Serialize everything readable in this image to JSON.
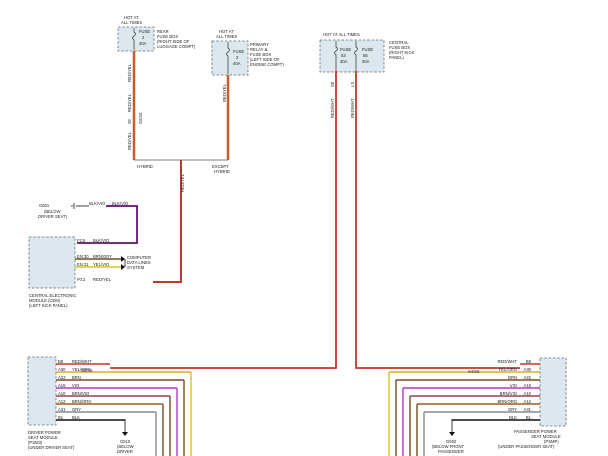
{
  "fuse_rear": {
    "hot": [
      "HOT AT",
      "ALL TIMES"
    ],
    "fuse": [
      "FUSE",
      "2",
      "40A"
    ],
    "location": [
      "REAR",
      "FUSE BOX",
      "(RIGHT SIDE OF",
      "LUGGAGE COMPT)"
    ]
  },
  "fuse_primary": {
    "hot": [
      "HOT AT",
      "ALL TIMES"
    ],
    "fuse": [
      "FUSE",
      "3",
      "40A"
    ],
    "location": [
      "PRIMARY",
      "RELAY &",
      "FUSE BOX",
      "(LEFT SIDE OF",
      "ENGINE COMPT)"
    ]
  },
  "fuse_central": {
    "hot": "HOT AT ALL TIMES",
    "fuse_a": [
      "FUSE",
      "53",
      "30A"
    ],
    "fuse_b": [
      "FUSE",
      "55",
      "30A"
    ],
    "location": [
      "CENTRAL",
      "FUSE BOX",
      "(RIGHT KICK",
      "PANEL)"
    ]
  },
  "wires": {
    "red_yel": "RED/YEL",
    "red_wht": "RED/WHT",
    "blk_vio": "BLK/VIO",
    "code_28": "28",
    "code_s8": "S8",
    "code_ls": "LS",
    "splice_label": "S4/S5",
    "hybrid": "HYBRID",
    "except_hybrid": [
      "EXCEPT",
      "HYBRID"
    ]
  },
  "ground_left": {
    "id": "G601",
    "wire": "BLK/VIO",
    "location": [
      "(BELOW",
      "DRIVER SEAT)"
    ]
  },
  "cem": {
    "pins": [
      {
        "pin": "F2:6",
        "wire": "BLK/VIO"
      },
      {
        "pin": "EN:30",
        "wire": "BRN/GRY"
      },
      {
        "pin": "EN:31",
        "wire": "YEL/VIO"
      },
      {
        "pin": "F0:2",
        "wire": "RED/YEL"
      }
    ],
    "network": [
      "COMPUTER",
      "DATA LINES",
      "SYSTEM"
    ],
    "name": [
      "CENTRAL ELECTRONIC",
      "MODULE (CEM)",
      "(LEFT KICK PANEL)"
    ]
  },
  "driver_module": {
    "pins": [
      {
        "pin": "B8",
        "wire": "RED/WHT"
      },
      {
        "pin": "A30",
        "wire": "YEL/ORG"
      },
      {
        "pin": "A22",
        "wire": "BRN"
      },
      {
        "pin": "A15",
        "wire": "VIO"
      },
      {
        "pin": "A10",
        "wire": "BRN/VIO"
      },
      {
        "pin": "A12",
        "wire": "BRN/ORG"
      },
      {
        "pin": "A31",
        "wire": "GRY"
      },
      {
        "pin": "B1",
        "wire": "BLK"
      }
    ],
    "name": [
      "DRIVER POWER",
      "SEAT MODULE",
      "(PSM3)",
      "(UNDER DRIVER SEAT)"
    ],
    "ground": [
      "G510",
      "(BELOW",
      "DRIVER"
    ]
  },
  "passenger_module": {
    "pins": [
      {
        "pin": "B8",
        "wire": "RED/WHT"
      },
      {
        "pin": "A30",
        "wire": "YEL/ORG"
      },
      {
        "pin": "A22",
        "wire": "BRN"
      },
      {
        "pin": "A15",
        "wire": "VIO"
      },
      {
        "pin": "A10",
        "wire": "BRN/VIO"
      },
      {
        "pin": "A12",
        "wire": "BRN/ORG"
      },
      {
        "pin": "A31",
        "wire": "GRY"
      },
      {
        "pin": "B1",
        "wire": "BLK"
      }
    ],
    "name": [
      "PASSENGER POWER",
      "SEAT MODULE",
      "(PSMP)",
      "(UNDER PASSENGER SEAT)"
    ],
    "ground": [
      "G502",
      "(BELOW FRONT",
      "PASSENGER"
    ]
  },
  "colors": {
    "red": "#c0392b",
    "orange": "#d9822b",
    "yellow": "#e0c020",
    "violet": "#b03cc0",
    "brown": "#7a4a22",
    "gray": "#8a8a8a",
    "black": "#111111",
    "box_fill": "#dde8ee"
  }
}
